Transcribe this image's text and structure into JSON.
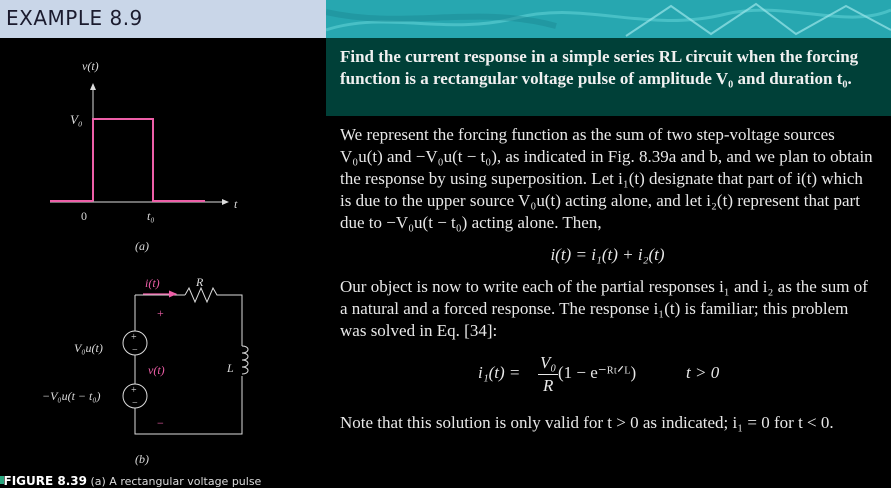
{
  "example": {
    "title": "EXAMPLE 8.9"
  },
  "problem": "Find the current response in a simple series RL circuit when the forcing function is a rectangular voltage pulse of amplitude V₀ and duration t₀.",
  "paragraph1": "We represent the forcing function as the sum of two step-voltage sources V₀u(t) and −V₀u(t − t₀), as indicated in Fig. 8.39a and b, and we plan to obtain the response by using superposition. Let i₁(t) designate that part of i(t) which is due to the upper source V₀u(t) acting alone, and let i₂(t) represent that part due to −V₀u(t − t₀) acting alone. Then,",
  "equation1": "i(t) = i₁(t) + i₂(t)",
  "paragraph2": "Our object is now to write each of the partial responses i₁ and i₂ as the sum of a natural and a forced response. The response i₁(t) is familiar; this problem was solved in Eq. [34]:",
  "equation2": {
    "lhs": "i₁(t) =",
    "num": "V₀",
    "den": "R",
    "rhs": "(1 − e⁻ᴿᵗᐟᴸ)",
    "cond": "t > 0"
  },
  "paragraph3": "Note that this solution is only valid for t > 0 as indicated; i₁ = 0 for t < 0.",
  "figure": {
    "a": {
      "ylabel": "v(t)",
      "xlabel": "t",
      "amp": "V₀",
      "origin": "0",
      "t0": "t₀",
      "tag": "(a)"
    },
    "b": {
      "current": "i(t)",
      "R": "R",
      "L": "L",
      "src1": "V₀u(t)",
      "src2": "−V₀u(t − t₀)",
      "v": "v(t)",
      "plus": "+",
      "minus": "−",
      "tag": "(b)"
    },
    "caption_label": "FIGURE 8.39",
    "caption_text": "(a) A rectangular voltage pulse"
  },
  "colors": {
    "pink": "#ee5fa8",
    "banner": "#27a7b0",
    "problem_bg": "#004038",
    "header_bg": "#c9d6e8"
  }
}
